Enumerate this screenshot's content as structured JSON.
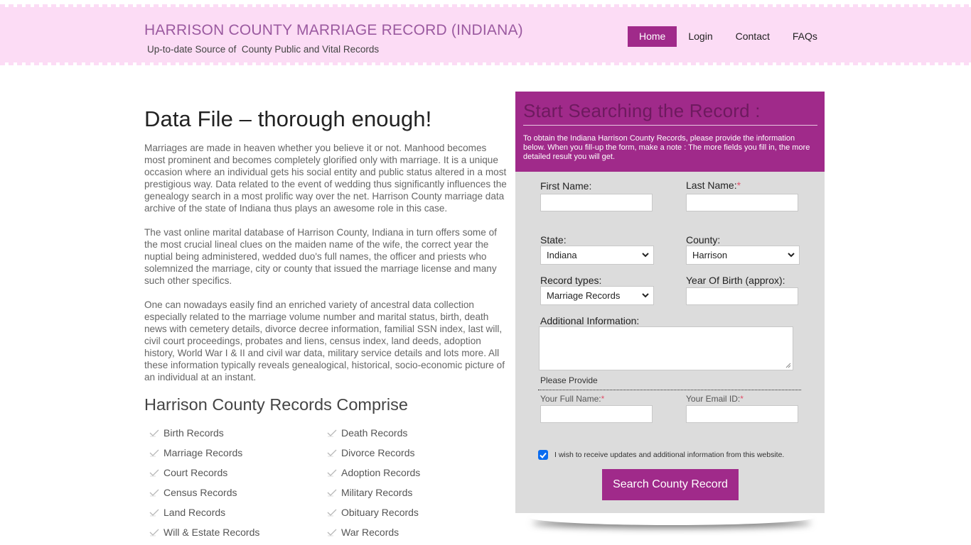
{
  "header": {
    "title": "HARRISON COUNTY MARRIAGE RECORD (INDIANA)",
    "tagline": "Up-to-date Source of  County Public and Vital Records",
    "nav": [
      {
        "label": "Home",
        "active": true
      },
      {
        "label": "Login",
        "active": false
      },
      {
        "label": "Contact",
        "active": false
      },
      {
        "label": "FAQs",
        "active": false
      }
    ]
  },
  "main": {
    "title": "Data File – thorough enough!",
    "paragraphs": [
      "Marriages are made in heaven whether you believe it or not. Manhood becomes most prominent and becomes completely glorified only with marriage. It is a unique occasion where an individual gets his social entity and public status altered in a most prestigious way. Data related to the event of wedding thus significantly influences the genealogy search in a most prolific way over the net. Harrison County marriage data archive of the state of Indiana thus plays an awesome role in this case.",
      "The vast online marital database of Harrison County, Indiana in turn offers some of the most crucial lineal clues on the maiden name of the wife, the correct year the nuptial being administered, wedded duo's full names, the officer and priests who solemnized the marriage, city or county that issued the marriage license and many such other specifics.",
      "One can nowadays easily find an enriched variety of ancestral data collection especially related to the marriage volume number and marital status, birth, death news with cemetery details, divorce decree information, familial SSN index, last will, civil court proceedings, probates and liens, census index, land deeds, adoption history, World War I & II and civil war data, military service details and lots more. All these information typically reveals genealogical, historical, socio-economic picture of an individual at an instant."
    ],
    "records_title": "Harrison County Records Comprise",
    "records": [
      "Birth Records",
      "Death Records",
      "Marriage Records",
      "Divorce Records",
      "Court Records",
      "Adoption Records",
      "Census Records",
      "Military Records",
      "Land Records",
      "Obituary Records",
      "Will & Estate Records",
      "War Records"
    ]
  },
  "search_panel": {
    "title": "Start Searching the Record :",
    "description": "To obtain the Indiana Harrison County Records, please provide the information below. When you fill-up the form, make a note : The more fields you fill in, the more detailed result you will get.",
    "first_name_label": "First Name:",
    "last_name_label": "Last Name:",
    "state_label": "State:",
    "state_value": "Indiana",
    "county_label": "County:",
    "county_value": "Harrison",
    "record_types_label": "Record types:",
    "record_types_value": "Marriage Records",
    "year_of_birth_label": "Year Of Birth (approx):",
    "additional_info_label": "Additional Information:",
    "please_provide": "Please Provide",
    "full_name_label": "Your Full Name:",
    "email_label": "Your Email ID:",
    "required_mark": "*",
    "consent_checked": true,
    "consent_text": "I wish to receive updates and additional information from this website.",
    "search_button": "Search County Record"
  },
  "colors": {
    "header_bg": "#fcdcf5",
    "accent": "#a02a8a",
    "panel_bg": "#dcdcdc",
    "title": "#9b5aa0",
    "required": "#e0506a"
  }
}
